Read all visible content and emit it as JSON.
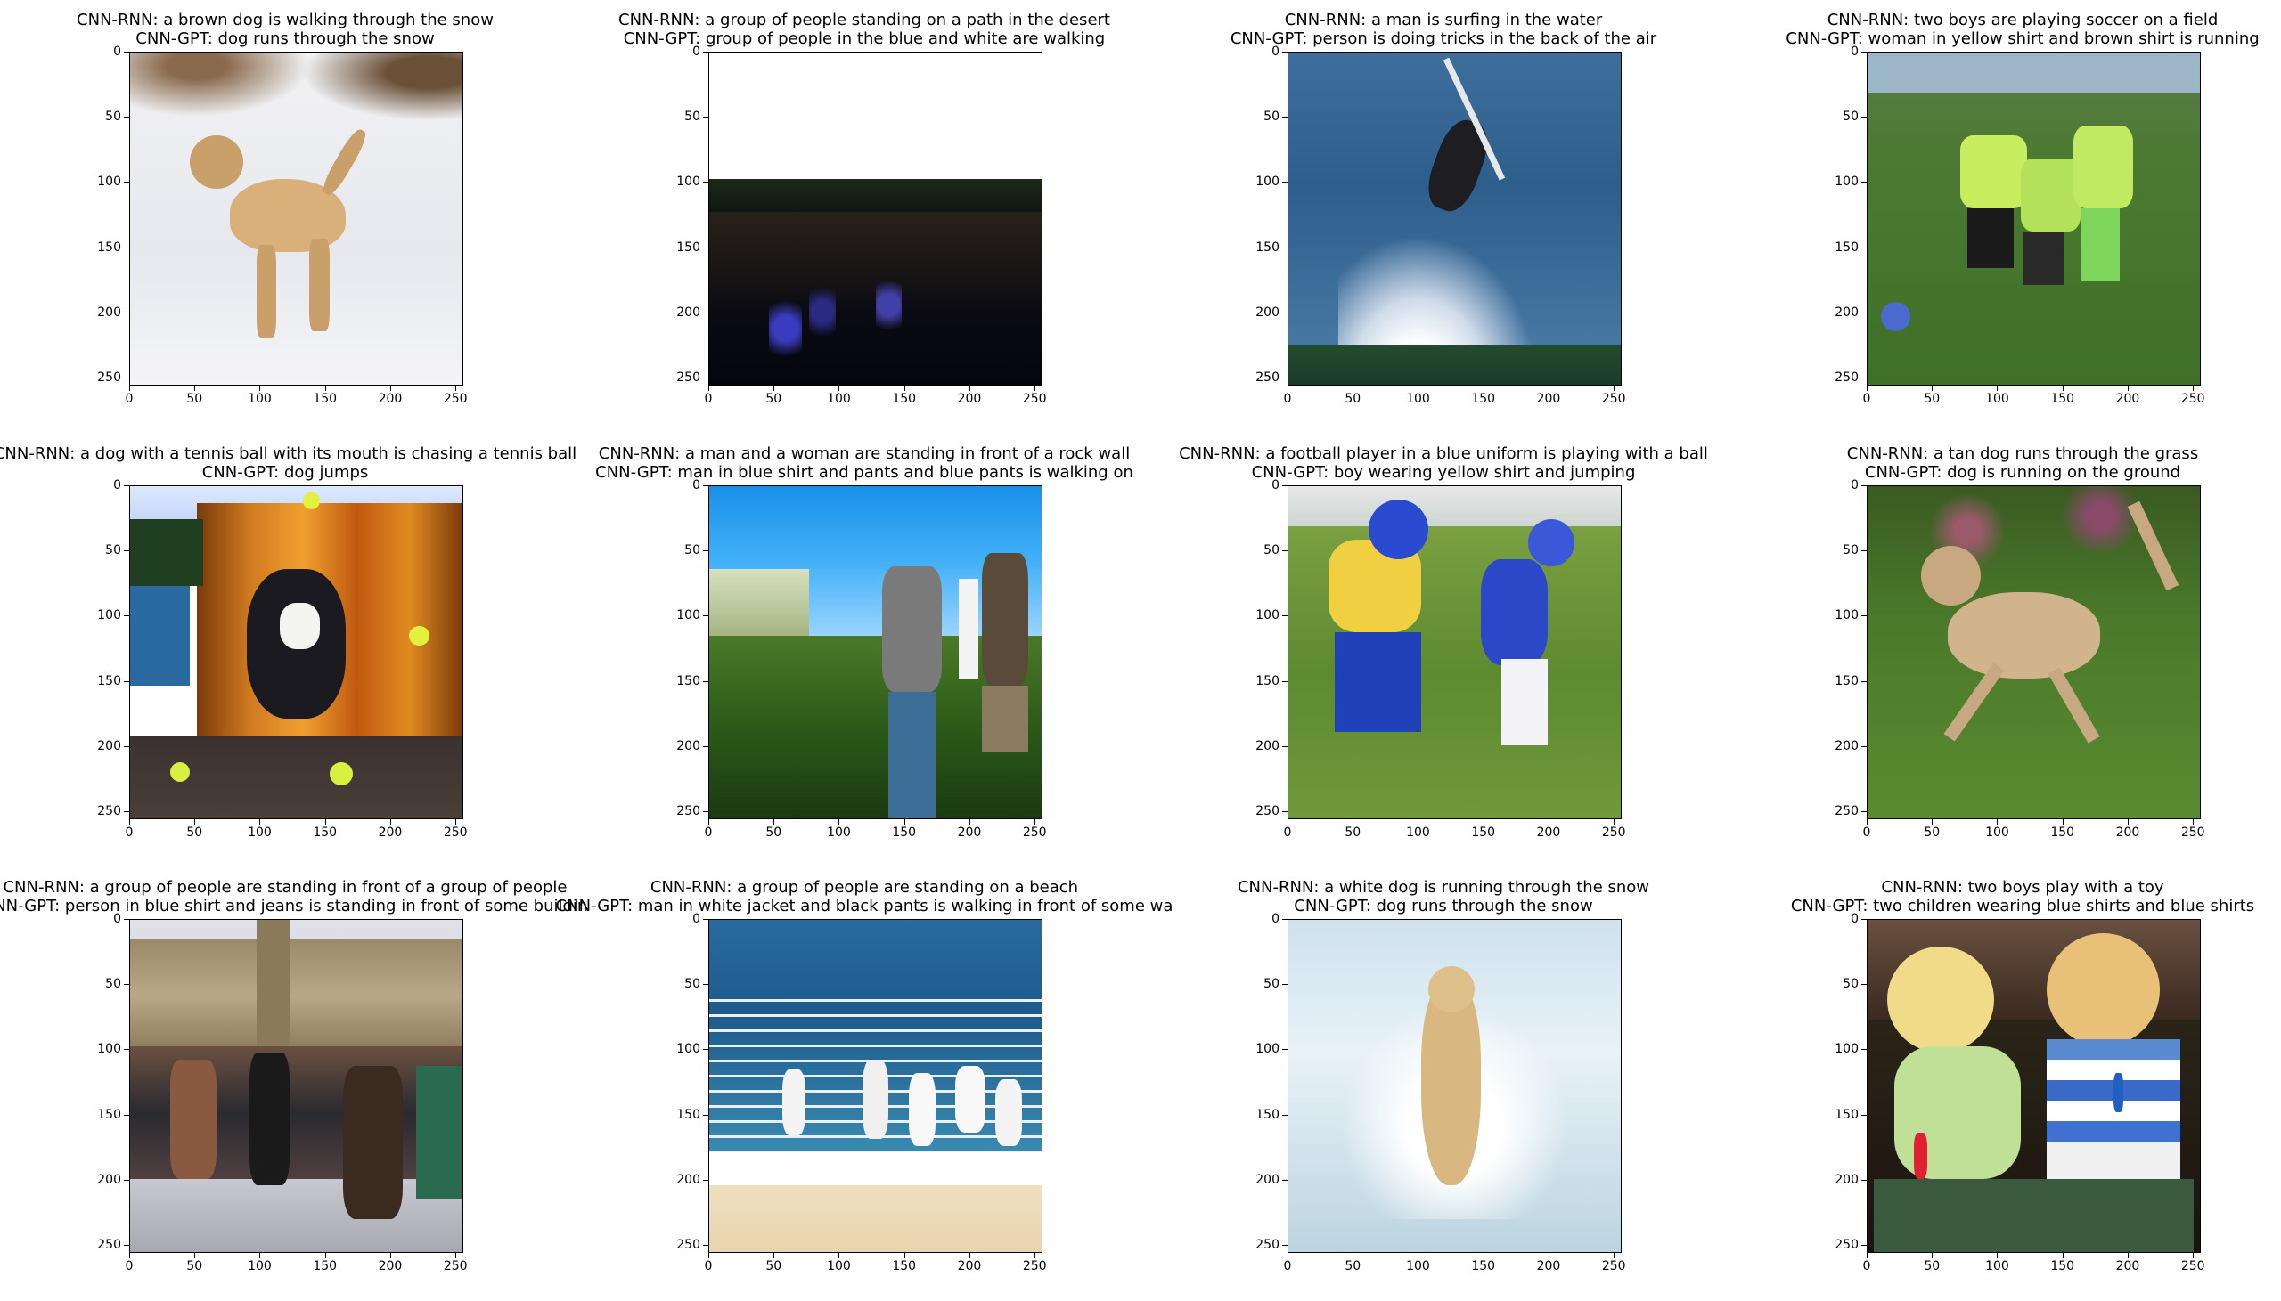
{
  "chart_data": {
    "type": "image-grid",
    "rows": 3,
    "cols": 4,
    "x_ticks": [
      "0",
      "50",
      "100",
      "150",
      "200",
      "250"
    ],
    "y_ticks": [
      "0",
      "50",
      "100",
      "150",
      "200",
      "250"
    ],
    "xlim": [
      0,
      256
    ],
    "ylim": [
      256,
      0
    ],
    "panels": [
      {
        "rnn": "CNN-RNN: a brown dog is walking through the snow",
        "gpt": "CNN-GPT: dog runs through the snow",
        "scene": "dog-snow"
      },
      {
        "rnn": "CNN-RNN: a group of people standing on a path in the desert",
        "gpt": "CNN-GPT: group of people in the blue and white are walking",
        "scene": "dark-hike"
      },
      {
        "rnn": "CNN-RNN: a man is surfing in the water",
        "gpt": "CNN-GPT: person is doing tricks in the back of the air",
        "scene": "surf"
      },
      {
        "rnn": "CNN-RNN: two boys are playing soccer on a field",
        "gpt": "CNN-GPT: woman in yellow shirt and brown shirt is running",
        "scene": "soccer"
      },
      {
        "rnn": "CNN-RNN: a dog with a tennis ball with its mouth is chasing a tennis ball",
        "gpt": "CNN-GPT: dog jumps",
        "scene": "dog-shed"
      },
      {
        "rnn": "CNN-RNN: a man and a woman are standing in front of a rock wall",
        "gpt": "CNN-GPT: man in blue shirt and pants and blue pants is walking on",
        "scene": "hill-people"
      },
      {
        "rnn": "CNN-RNN: a football player in a blue uniform is playing with a ball",
        "gpt": "CNN-GPT: boy wearing yellow shirt and jumping",
        "scene": "football"
      },
      {
        "rnn": "CNN-RNN: a tan dog runs through the grass",
        "gpt": "CNN-GPT: dog is running on the ground",
        "scene": "dog-grass"
      },
      {
        "rnn": "CNN-RNN: a group of people are standing in front of a group of people",
        "gpt": "CNN-GPT: person in blue shirt and jeans is standing in front of some buildin",
        "scene": "crowd-building"
      },
      {
        "rnn": "CNN-RNN: a group of people are standing on a beach",
        "gpt": "CNN-GPT: man in white jacket and black pants is walking in front of some wa",
        "scene": "beach"
      },
      {
        "rnn": "CNN-RNN: a white dog is running through the snow",
        "gpt": "CNN-GPT: dog runs through the snow",
        "scene": "dog-snow-run"
      },
      {
        "rnn": "CNN-RNN: two boys play with a toy",
        "gpt": "CNN-GPT: two children wearing blue shirts and blue shirts",
        "scene": "two-boys"
      }
    ]
  }
}
